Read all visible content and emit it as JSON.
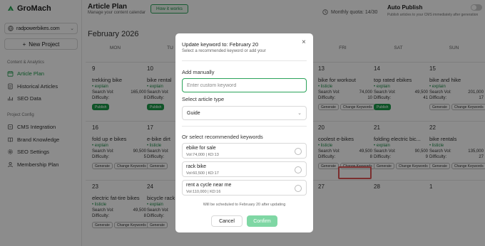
{
  "app": {
    "brand": "GroMach"
  },
  "sidebar": {
    "site": "radpowerbikes.com",
    "new_project": "New Project",
    "section1": "Content & Analytics",
    "section2": "Project Config",
    "items": [
      {
        "label": "Article Plan",
        "icon": "calendar-icon"
      },
      {
        "label": "Historical Articles",
        "icon": "document-icon"
      },
      {
        "label": "SEO Data",
        "icon": "chart-icon"
      },
      {
        "label": "CMS Integration",
        "icon": "plug-icon"
      },
      {
        "label": "Brand Knowledge",
        "icon": "book-icon"
      },
      {
        "label": "SEO Settings",
        "icon": "gear-icon"
      },
      {
        "label": "Membership Plan",
        "icon": "user-icon"
      }
    ]
  },
  "header": {
    "title": "Article Plan",
    "subtitle": "Manage your content calendar",
    "how_label": "How it works",
    "quota": "Monthly quota: 14/30",
    "auto_title": "Auto Publish",
    "auto_desc": "Publish articles to your CMS immediately after generation"
  },
  "calendar": {
    "month": "February 2026",
    "weekdays": [
      "MON",
      "TU",
      "FRI",
      "SAT",
      "SUN"
    ],
    "vol_label": "Search Vol:",
    "diff_label": "Difficulty:",
    "cells": [
      {
        "day": "9",
        "kw": "trekking bike",
        "type": "explain",
        "vol": "165,000",
        "diff": "8",
        "buttons": [
          "Publish"
        ]
      },
      {
        "day": "10",
        "kw": "bike rental",
        "type": "explain",
        "vol": "",
        "diff": "",
        "buttons": [
          "Publish"
        ]
      },
      {
        "day": "13",
        "kw": "bike for workout",
        "type": "listicle",
        "vol": "74,000",
        "diff": "10",
        "buttons": [
          "Generate",
          "Change Keywords"
        ]
      },
      {
        "day": "14",
        "kw": "top rated ebikes",
        "type": "explain",
        "vol": "49,500",
        "diff": "41",
        "buttons": [
          "Publish"
        ]
      },
      {
        "day": "15",
        "kw": "bike and hike",
        "type": "explain",
        "vol": "201,000",
        "diff": "17",
        "buttons": [
          "Generate",
          "Change Keywords"
        ]
      },
      {
        "day": "16",
        "kw": "fold up e bikes",
        "type": "explain",
        "vol": "90,500",
        "diff": "5",
        "buttons": [
          "Generate",
          "Change Keywords"
        ]
      },
      {
        "day": "17",
        "kw": "e-bike dirt",
        "type": "listicle",
        "vol": "",
        "diff": "",
        "buttons": [
          "Generate"
        ]
      },
      {
        "day": "20",
        "kw": "coolest e-bikes",
        "type": "listicle",
        "vol": "49,500",
        "diff": "8",
        "buttons": [
          "Generate",
          "Change Keywords"
        ]
      },
      {
        "day": "21",
        "kw": "folding electric bic...",
        "type": "explain",
        "vol": "90,500",
        "diff": "9",
        "buttons": [
          "Generate",
          "Change Keywords"
        ]
      },
      {
        "day": "22",
        "kw": "bike rentals",
        "type": "listicle",
        "vol": "135,000",
        "diff": "27",
        "buttons": [
          "Generate",
          "Change Keywords"
        ]
      },
      {
        "day": "23",
        "kw": "electric fat-tire bikes",
        "type": "listicle",
        "vol": "49,500",
        "diff": "8",
        "buttons": [
          "Generate",
          "Change Keywords"
        ]
      },
      {
        "day": "24",
        "kw": "bicycle rack",
        "type": "explain",
        "vol": "",
        "diff": "",
        "buttons": [
          "Generate"
        ]
      },
      {
        "day": "27",
        "kw": "",
        "type": "",
        "vol": "",
        "diff": "",
        "buttons": []
      },
      {
        "day": "28",
        "kw": "",
        "type": "",
        "vol": "",
        "diff": "",
        "buttons": []
      },
      {
        "day": "1",
        "kw": "",
        "type": "",
        "vol": "",
        "diff": "",
        "buttons": []
      }
    ]
  },
  "modal": {
    "title": "Update keyword to: February 20",
    "subtitle": "Select a recommended keyword or add your",
    "add_label": "Add manually",
    "input_placeholder": "Enter custom keyword",
    "type_label": "Select article type",
    "type_value": "Guide",
    "rec_label": "Or select recommended keywords",
    "options": [
      {
        "kw": "ebike for sale",
        "meta": "Vol:74,000  |  KD:13"
      },
      {
        "kw": "rack bike",
        "meta": "Vol:60,500  |  KD:17"
      },
      {
        "kw": "rent a cycle near me",
        "meta": "Vol:110,000  |  KD:16"
      }
    ],
    "note": "Will be scheduled to February 20 after updating",
    "cancel": "Cancel",
    "confirm": "Confirm"
  },
  "colors": {
    "accent": "#1d9a4a",
    "highlight": "#e05656"
  }
}
